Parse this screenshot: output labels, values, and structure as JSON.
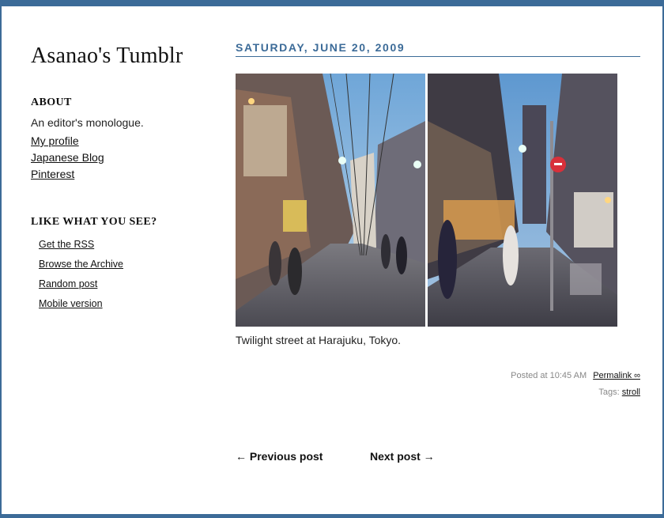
{
  "blog": {
    "title": "Asanao's Tumblr"
  },
  "about": {
    "heading": "ABOUT",
    "text": "An editor's monologue.",
    "links": [
      "My profile",
      "Japanese Blog",
      "Pinterest"
    ]
  },
  "like": {
    "heading": "LIKE WHAT YOU SEE?",
    "links": [
      "Get the RSS",
      "Browse the Archive",
      "Random post",
      "Mobile version"
    ]
  },
  "post": {
    "date": "SATURDAY, JUNE 20, 2009",
    "caption": "Twilight street at Harajuku, Tokyo.",
    "posted_at": "Posted at 10:45 AM",
    "permalink": "Permalink ∞",
    "tags_label": "Tags:",
    "tag": "stroll"
  },
  "pager": {
    "prev": "← Previous post",
    "next": "Next post →"
  },
  "colors": {
    "accent": "#3c6b98",
    "text": "#222222",
    "meta": "#888888"
  }
}
